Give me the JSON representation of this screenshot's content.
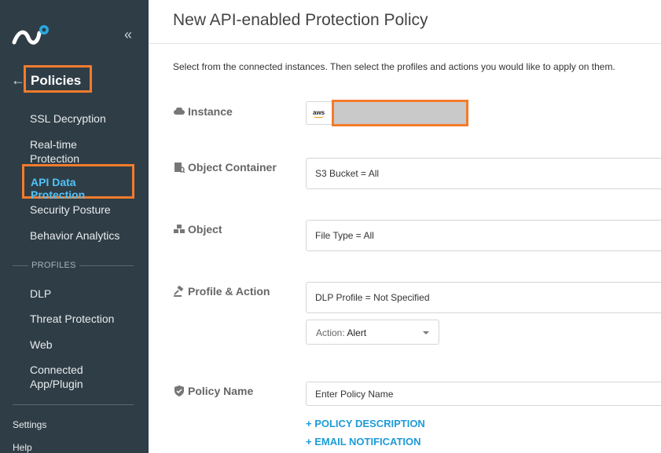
{
  "sidebar": {
    "collapse_glyph": "«",
    "back_glyph": "←",
    "title": "Policies",
    "items": [
      {
        "label": "SSL Decryption"
      },
      {
        "label": "Real-time\nProtection"
      },
      {
        "label": "API Data Protection",
        "active": true
      },
      {
        "label": "Security Posture"
      },
      {
        "label": "Behavior Analytics"
      }
    ],
    "profiles_label": "PROFILES",
    "profile_items": [
      {
        "label": "DLP"
      },
      {
        "label": "Threat Protection"
      },
      {
        "label": "Web"
      },
      {
        "label": "Connected\nApp/Plugin"
      }
    ],
    "footer_items": [
      {
        "label": "Settings"
      },
      {
        "label": "Help"
      }
    ]
  },
  "header": {
    "title": "New API-enabled Protection Policy"
  },
  "main": {
    "intro": "Select from the connected instances. Then select the profiles and actions you would like to apply on them.",
    "instance": {
      "label": "Instance",
      "provider_badge": "aws",
      "icon": "cloud-icon"
    },
    "object_container": {
      "label": "Object Container",
      "value": "S3 Bucket = All",
      "icon": "container-icon"
    },
    "object": {
      "label": "Object",
      "value": "File Type = All",
      "icon": "objects-icon"
    },
    "profile_action": {
      "label": "Profile & Action",
      "value": "DLP Profile = Not Specified",
      "icon": "gavel-icon",
      "action_key": "Action:",
      "action_value": "Alert"
    },
    "policy_name": {
      "label": "Policy Name",
      "placeholder": "Enter Policy Name",
      "icon": "shield-icon"
    },
    "links": {
      "description": "+ POLICY DESCRIPTION",
      "email": "+ EMAIL NOTIFICATION"
    }
  },
  "colors": {
    "sidebar_bg": "#2f3d46",
    "highlight": "#f47b2c",
    "active_text": "#4fc3f7",
    "link": "#1e9bd7"
  }
}
